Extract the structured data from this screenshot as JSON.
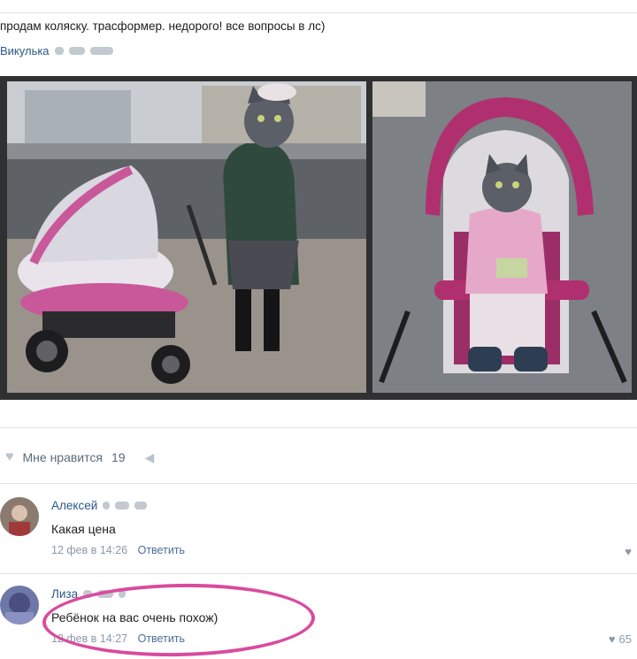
{
  "post": {
    "text": "продам коляску. трасформер. недорого! все вопросы в лс)",
    "author": "Викулька"
  },
  "likes": {
    "label": "Мне нравится",
    "count": "19"
  },
  "comments": [
    {
      "name": "Алексей",
      "text": "Какая цена",
      "date": "12 фев в 14:26",
      "reply": "Ответить"
    },
    {
      "name": "Лиза",
      "text": "Ребёнок на вас очень похож)",
      "date": "12 фев в 14:27",
      "reply": "Ответить",
      "likes": "65"
    }
  ],
  "icons": {
    "heart": "heart-icon",
    "share": "megaphone-icon"
  },
  "colors": {
    "link": "#2a5885",
    "meta": "#8a9aab",
    "highlight": "#d94b9f"
  }
}
